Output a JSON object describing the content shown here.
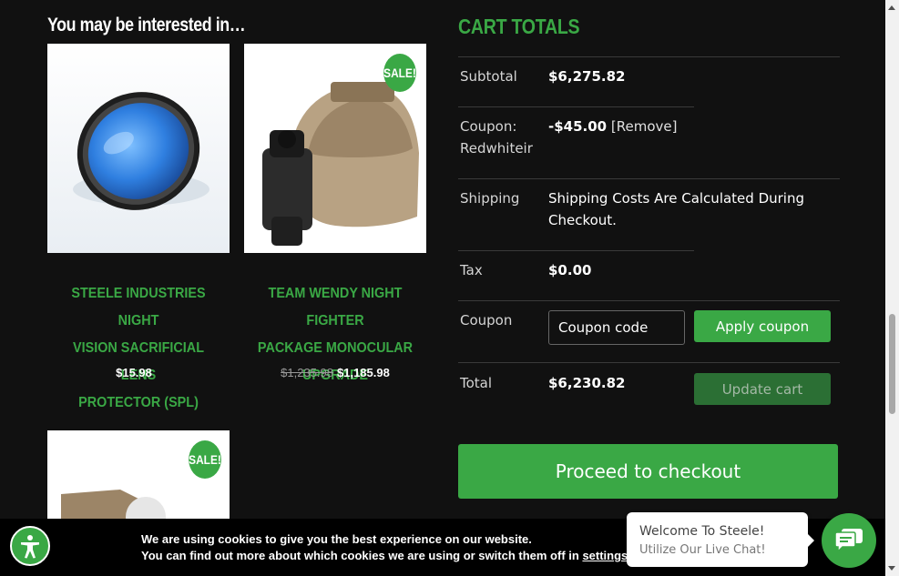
{
  "interested": {
    "title": "You may be interested in…",
    "products": [
      {
        "name_lines": [
          "STEELE INDUSTRIES NIGHT",
          "VISION SACRIFICIAL LENS",
          "PROTECTOR (SPL)"
        ],
        "price": "$15.98",
        "old_price": "",
        "sale": false
      },
      {
        "name_lines": [
          "TEAM WENDY NIGHT FIGHTER",
          "PACKAGE MONOCULAR",
          "UPGRADE"
        ],
        "price": "$1,185.98",
        "old_price": "$1,235.98",
        "sale": true,
        "sale_label": "SALE!"
      },
      {
        "sale": true,
        "sale_label": "SALE!"
      }
    ]
  },
  "cart": {
    "title": "CART TOTALS",
    "subtotal_label": "Subtotal",
    "subtotal_value": "$6,275.82",
    "coupon_label_1": "Coupon:",
    "coupon_label_2": "Redwhiteir",
    "coupon_value": "-$45.00",
    "coupon_remove": "[Remove]",
    "shipping_label": "Shipping",
    "shipping_value_1": "Shipping Costs Are Calculated During",
    "shipping_value_2": "Checkout.",
    "tax_label": "Tax",
    "tax_value": "$0.00",
    "coupon_field_label": "Coupon",
    "coupon_placeholder": "Coupon code",
    "apply_coupon": "Apply coupon",
    "total_label": "Total",
    "total_value": "$6,230.82",
    "update_cart": "Update cart",
    "checkout": "Proceed to checkout"
  },
  "cookie": {
    "line1": "We are using cookies to give you the best experience on our website.",
    "line2": "You can find out more about which cookies we are using or switch them off in",
    "link": "settings",
    "period": "."
  },
  "chat": {
    "line1": "Welcome To Steele!",
    "line2": "Utilize Our Live Chat!"
  },
  "colors": {
    "accent": "#3aa845",
    "background": "#111111"
  }
}
